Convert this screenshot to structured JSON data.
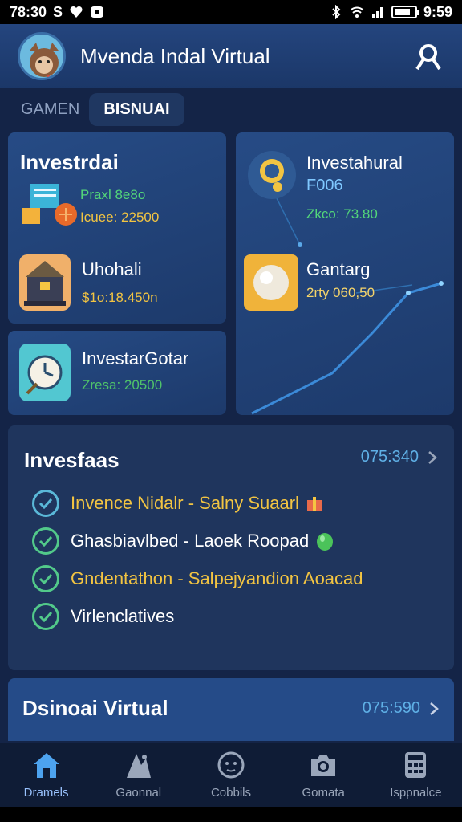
{
  "status_bar": {
    "left_time": "78:30",
    "left_extra": "S",
    "right_time": "9:59",
    "battery_percent": 78
  },
  "header": {
    "title": "Mvenda Indal Virtual"
  },
  "tabs": [
    {
      "label": "GAMEN"
    },
    {
      "label": "BISNUAI"
    }
  ],
  "card_left_top": {
    "title": "Investrdai",
    "item1": {
      "line1": "Praxl 8e8o",
      "line2": "Icuee: 22500"
    },
    "item2": {
      "name": "Uhohali",
      "value": "$1o:18.450n"
    }
  },
  "card_left_bottom": {
    "name": "InvestarGotar",
    "value": "Zresa: 20500"
  },
  "card_right": {
    "item1": {
      "name": "Investahural",
      "subtitle": "F006",
      "value": "Zkco: 73.80"
    },
    "item2": {
      "name": "Gantarg",
      "value": "2rty 060,50"
    }
  },
  "list_card": {
    "title": "Invesfaas",
    "value": "075:340",
    "items": [
      {
        "text": "Invence Nidalr - Salny Suaarl",
        "color": "#f2c442"
      },
      {
        "text": "Ghasbiavlbed - Laoek Roopad",
        "color": "#ffffff"
      },
      {
        "text": "Gndentathon - Salpejyandion Aoacad",
        "color": "#f2c442"
      },
      {
        "text": "Virlenclatives",
        "color": "#ffffff"
      }
    ]
  },
  "bottom_card": {
    "title": "Dsinoai Virtual",
    "value": "075:590"
  },
  "bottom_nav": [
    {
      "label": "Dramels",
      "icon": "home-icon",
      "active": true
    },
    {
      "label": "Gaonnal",
      "icon": "games-icon",
      "active": false
    },
    {
      "label": "Cobbils",
      "icon": "emoji-icon",
      "active": false
    },
    {
      "label": "Gomata",
      "icon": "camera-icon",
      "active": false
    },
    {
      "label": "Isppnalce",
      "icon": "calculator-icon",
      "active": false
    }
  ]
}
